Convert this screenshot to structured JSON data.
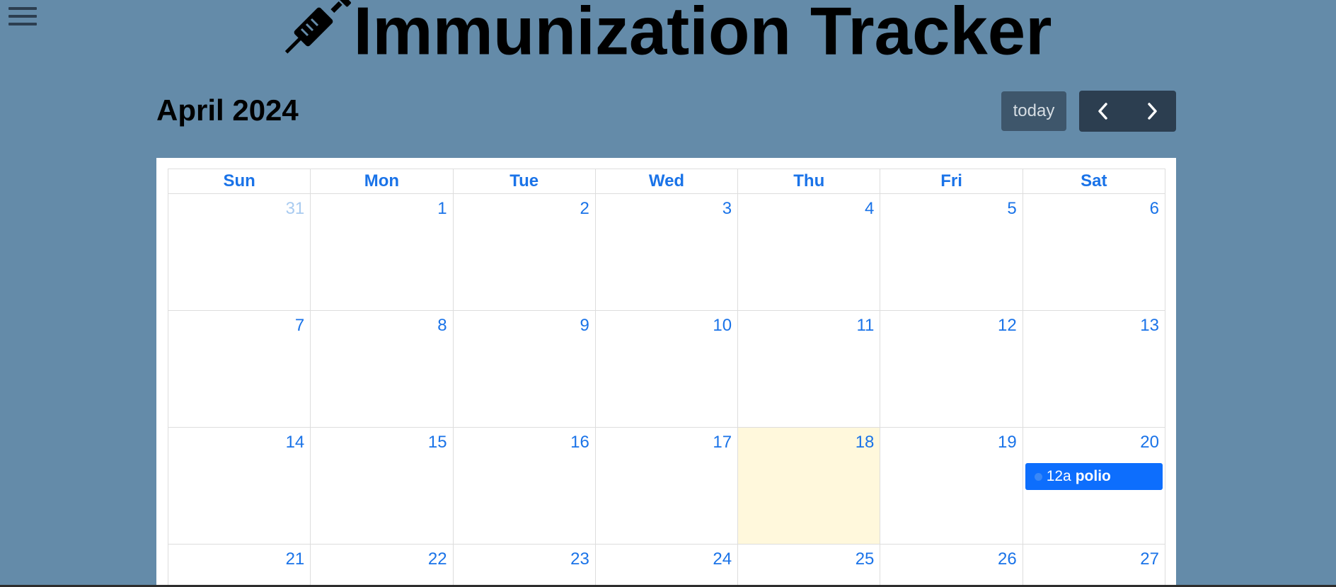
{
  "app": {
    "title": "Immunization Tracker"
  },
  "icons": {
    "menu": "hamburger-menu-icon",
    "logo": "syringe-icon",
    "prev": "chevron-left-icon",
    "next": "chevron-right-icon"
  },
  "colors": {
    "background": "#648ba9",
    "accent": "#1a73e8",
    "event": "#0d6efd",
    "today_highlight": "#fff8dc",
    "nav_button": "#2c3e50",
    "today_button": "#3e566b"
  },
  "calendar": {
    "month_label": "April 2024",
    "today_button_label": "today",
    "weekdays": [
      "Sun",
      "Mon",
      "Tue",
      "Wed",
      "Thu",
      "Fri",
      "Sat"
    ],
    "weeks": [
      [
        {
          "day": "31",
          "other_month": true
        },
        {
          "day": "1"
        },
        {
          "day": "2"
        },
        {
          "day": "3"
        },
        {
          "day": "4"
        },
        {
          "day": "5"
        },
        {
          "day": "6"
        }
      ],
      [
        {
          "day": "7"
        },
        {
          "day": "8"
        },
        {
          "day": "9"
        },
        {
          "day": "10"
        },
        {
          "day": "11"
        },
        {
          "day": "12"
        },
        {
          "day": "13"
        }
      ],
      [
        {
          "day": "14"
        },
        {
          "day": "15"
        },
        {
          "day": "16"
        },
        {
          "day": "17"
        },
        {
          "day": "18",
          "today": true
        },
        {
          "day": "19"
        },
        {
          "day": "20",
          "events": [
            {
              "time": "12a",
              "title": "polio"
            }
          ]
        }
      ],
      [
        {
          "day": "21"
        },
        {
          "day": "22"
        },
        {
          "day": "23"
        },
        {
          "day": "24"
        },
        {
          "day": "25"
        },
        {
          "day": "26"
        },
        {
          "day": "27"
        }
      ]
    ]
  }
}
